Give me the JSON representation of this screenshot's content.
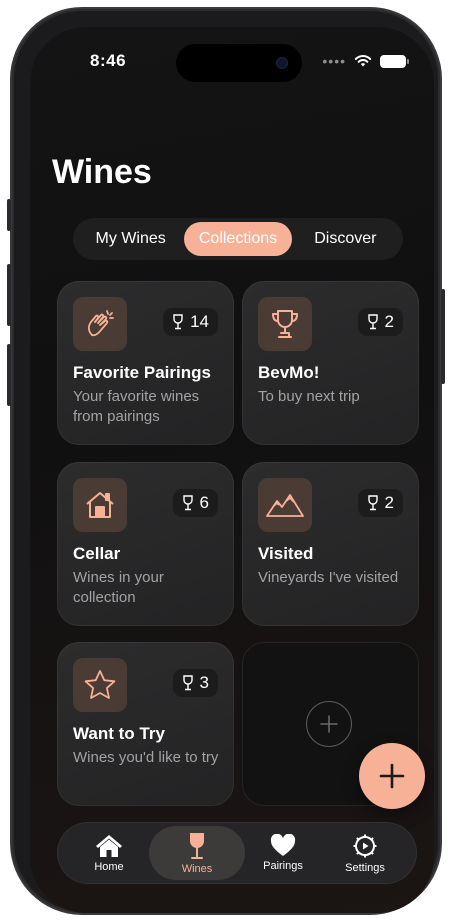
{
  "status": {
    "time": "8:46",
    "signal_dots": "••••"
  },
  "page_title": "Wines",
  "segments": [
    {
      "label": "My Wines",
      "active": false
    },
    {
      "label": "Collections",
      "active": true
    },
    {
      "label": "Discover",
      "active": false
    }
  ],
  "collections": [
    {
      "icon": "clapping-hands-icon",
      "count": "14",
      "title": "Favorite Pairings",
      "description": "Your favorite wines from pairings"
    },
    {
      "icon": "trophy-icon",
      "count": "2",
      "title": "BevMo!",
      "description": "To buy next trip"
    },
    {
      "icon": "house-icon",
      "count": "6",
      "title": "Cellar",
      "description": "Wines in your collection"
    },
    {
      "icon": "mountains-icon",
      "count": "2",
      "title": "Visited",
      "description": "Vineyards I've visited"
    },
    {
      "icon": "star-icon",
      "count": "3",
      "title": "Want to Try",
      "description": "Wines you'd like to try"
    }
  ],
  "tabs": [
    {
      "label": "Home",
      "icon": "house-icon"
    },
    {
      "label": "Wines",
      "icon": "wine-glass-icon",
      "active": true
    },
    {
      "label": "Pairings",
      "icon": "heart-icon"
    },
    {
      "label": "Settings",
      "icon": "gear-icon"
    }
  ],
  "colors": {
    "accent": "#f7b196",
    "card": "#2a2a2b",
    "icon_tile": "#4a3b34",
    "background": "#121212"
  }
}
